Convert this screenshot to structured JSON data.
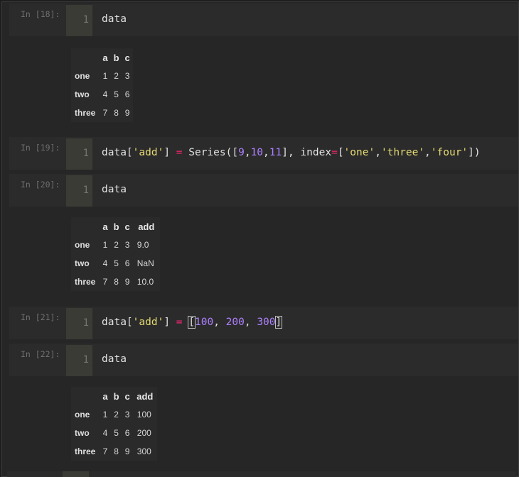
{
  "cells": [
    {
      "prompt": "In [18]:",
      "line": "1",
      "code": [
        {
          "t": "data",
          "c": ""
        }
      ],
      "output": {
        "columns": [
          "a",
          "b",
          "c"
        ],
        "rows": [
          {
            "index": "one",
            "values": [
              "1",
              "2",
              "3"
            ]
          },
          {
            "index": "two",
            "values": [
              "4",
              "5",
              "6"
            ]
          },
          {
            "index": "three",
            "values": [
              "7",
              "8",
              "9"
            ]
          }
        ]
      }
    },
    {
      "prompt": "In [19]:",
      "line": "1",
      "code": [
        {
          "t": "data[",
          "c": ""
        },
        {
          "t": "'add'",
          "c": "str"
        },
        {
          "t": "] ",
          "c": ""
        },
        {
          "t": "=",
          "c": "op"
        },
        {
          "t": " Series([",
          "c": ""
        },
        {
          "t": "9",
          "c": "num"
        },
        {
          "t": ",",
          "c": ""
        },
        {
          "t": "10",
          "c": "num"
        },
        {
          "t": ",",
          "c": ""
        },
        {
          "t": "11",
          "c": "num"
        },
        {
          "t": "], index",
          "c": ""
        },
        {
          "t": "=",
          "c": "op"
        },
        {
          "t": "[",
          "c": ""
        },
        {
          "t": "'one'",
          "c": "str"
        },
        {
          "t": ",",
          "c": ""
        },
        {
          "t": "'three'",
          "c": "str"
        },
        {
          "t": ",",
          "c": ""
        },
        {
          "t": "'four'",
          "c": "str"
        },
        {
          "t": "])",
          "c": ""
        }
      ]
    },
    {
      "prompt": "In [20]:",
      "line": "1",
      "code": [
        {
          "t": "data",
          "c": ""
        }
      ],
      "output": {
        "columns": [
          "a",
          "b",
          "c",
          "add"
        ],
        "rows": [
          {
            "index": "one",
            "values": [
              "1",
              "2",
              "3",
              "9.0"
            ]
          },
          {
            "index": "two",
            "values": [
              "4",
              "5",
              "6",
              "NaN"
            ]
          },
          {
            "index": "three",
            "values": [
              "7",
              "8",
              "9",
              "10.0"
            ]
          }
        ]
      }
    },
    {
      "prompt": "In [21]:",
      "line": "1",
      "code": [
        {
          "t": "data[",
          "c": ""
        },
        {
          "t": "'add'",
          "c": "str"
        },
        {
          "t": "] ",
          "c": ""
        },
        {
          "t": "=",
          "c": "op"
        },
        {
          "t": " ",
          "c": ""
        },
        {
          "t": "[",
          "c": "bm"
        },
        {
          "t": "100",
          "c": "num"
        },
        {
          "t": ", ",
          "c": ""
        },
        {
          "t": "200",
          "c": "num"
        },
        {
          "t": ", ",
          "c": ""
        },
        {
          "t": "300",
          "c": "num"
        },
        {
          "t": "]",
          "c": "bm"
        }
      ]
    },
    {
      "prompt": "In [22]:",
      "line": "1",
      "code": [
        {
          "t": "data",
          "c": ""
        }
      ],
      "output": {
        "columns": [
          "a",
          "b",
          "c",
          "add"
        ],
        "rows": [
          {
            "index": "one",
            "values": [
              "1",
              "2",
              "3",
              "100"
            ]
          },
          {
            "index": "two",
            "values": [
              "4",
              "5",
              "6",
              "200"
            ]
          },
          {
            "index": "three",
            "values": [
              "7",
              "8",
              "9",
              "300"
            ]
          }
        ]
      }
    }
  ]
}
